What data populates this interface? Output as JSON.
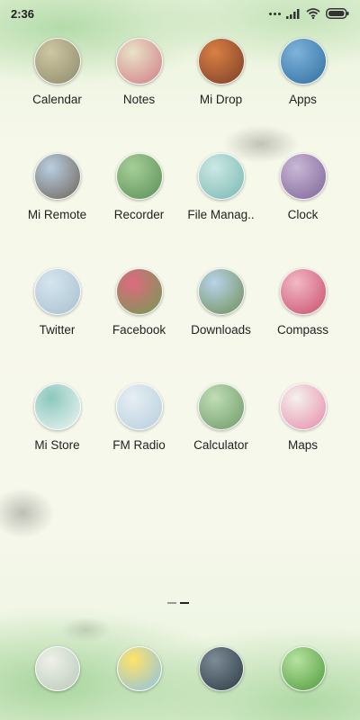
{
  "status_bar": {
    "time": "2:36",
    "icons": [
      "signal-dots-icon",
      "cellular-signal-icon",
      "wifi-icon",
      "battery-icon"
    ]
  },
  "apps": [
    {
      "label": "Calendar",
      "icon": "calendar-icon",
      "colors": [
        "#cfc7a2",
        "#8d8a6c"
      ]
    },
    {
      "label": "Notes",
      "icon": "notes-icon",
      "colors": [
        "#e9e2c8",
        "#d07d84"
      ]
    },
    {
      "label": "Mi Drop",
      "icon": "mi-drop-icon",
      "colors": [
        "#d98044",
        "#7c3e26"
      ]
    },
    {
      "label": "Apps",
      "icon": "apps-icon",
      "colors": [
        "#7fb3da",
        "#2f6ea0"
      ]
    },
    {
      "label": "Mi Remote",
      "icon": "mi-remote-icon",
      "colors": [
        "#b8cfe2",
        "#6e6356"
      ]
    },
    {
      "label": "Recorder",
      "icon": "recorder-icon",
      "colors": [
        "#a6cf98",
        "#5a8f55"
      ]
    },
    {
      "label": "File Manag..",
      "icon": "file-manager-icon",
      "colors": [
        "#cde8e4",
        "#78b8b2"
      ]
    },
    {
      "label": "Clock",
      "icon": "clock-icon",
      "colors": [
        "#c9b8d6",
        "#7e6597"
      ]
    },
    {
      "label": "Twitter",
      "icon": "twitter-icon",
      "colors": [
        "#d6e5ee",
        "#a7c0cf"
      ]
    },
    {
      "label": "Facebook",
      "icon": "facebook-icon",
      "colors": [
        "#df6a7f",
        "#6f9c52"
      ]
    },
    {
      "label": "Downloads",
      "icon": "downloads-icon",
      "colors": [
        "#b9d3ea",
        "#6f8f55"
      ]
    },
    {
      "label": "Compass",
      "icon": "compass-icon",
      "colors": [
        "#f2b9c5",
        "#c94d6d"
      ]
    },
    {
      "label": "Mi Store",
      "icon": "mi-store-icon",
      "colors": [
        "#8cc8be",
        "#eef5f3"
      ]
    },
    {
      "label": "FM Radio",
      "icon": "fm-radio-icon",
      "colors": [
        "#e6eef4",
        "#b6cfdc"
      ]
    },
    {
      "label": "Calculator",
      "icon": "calculator-icon",
      "colors": [
        "#c1ddb7",
        "#6d9a66"
      ]
    },
    {
      "label": "Maps",
      "icon": "maps-icon",
      "colors": [
        "#f4f2ef",
        "#e78aa7"
      ]
    }
  ],
  "pager": {
    "pages": 2,
    "current": 2
  },
  "dock": [
    {
      "icon": "dock-phone-icon",
      "colors": [
        "#eef1ea",
        "#b9c9b8"
      ]
    },
    {
      "icon": "dock-messages-icon",
      "colors": [
        "#ffe36a",
        "#8bc2e6"
      ]
    },
    {
      "icon": "dock-browser-icon",
      "colors": [
        "#7d8c96",
        "#2c3a44"
      ]
    },
    {
      "icon": "dock-camera-icon",
      "colors": [
        "#b6e3a0",
        "#4f9a3c"
      ]
    }
  ]
}
